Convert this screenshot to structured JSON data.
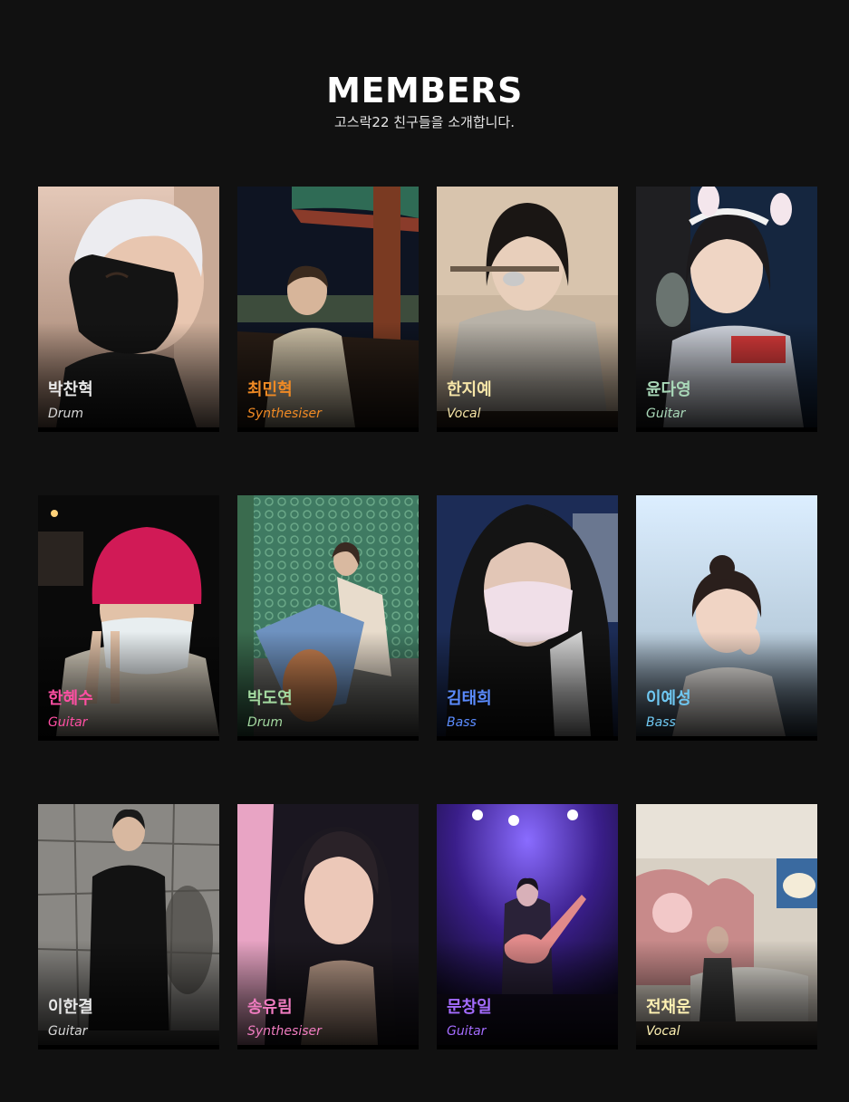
{
  "page": {
    "title": "MEMBERS",
    "subtitle": "고스락22 친구들을 소개합니다."
  },
  "members": [
    {
      "name": "박찬혁",
      "role": "Drum",
      "name_color": "#e8e8e8",
      "role_color": "#d8d8d8"
    },
    {
      "name": "최민혁",
      "role": "Synthesiser",
      "name_color": "#f08a24",
      "role_color": "#f08a24"
    },
    {
      "name": "한지예",
      "role": "Vocal",
      "name_color": "#f7e6a8",
      "role_color": "#f7e6a8"
    },
    {
      "name": "윤다영",
      "role": "Guitar",
      "name_color": "#a9d8b8",
      "role_color": "#a9d8b8"
    },
    {
      "name": "한혜수",
      "role": "Guitar",
      "name_color": "#ff4fa3",
      "role_color": "#ff4fa3"
    },
    {
      "name": "박도연",
      "role": "Drum",
      "name_color": "#a3d9a0",
      "role_color": "#a3d9a0"
    },
    {
      "name": "김태희",
      "role": "Bass",
      "name_color": "#5b8cff",
      "role_color": "#5b8cff"
    },
    {
      "name": "이예성",
      "role": "Bass",
      "name_color": "#6fc8f2",
      "role_color": "#6fc8f2"
    },
    {
      "name": "이한결",
      "role": "Guitar",
      "name_color": "#e8e8e8",
      "role_color": "#d8d8d8"
    },
    {
      "name": "송유림",
      "role": "Synthesiser",
      "name_color": "#f07cc0",
      "role_color": "#f07cc0"
    },
    {
      "name": "문창일",
      "role": "Guitar",
      "name_color": "#a46cff",
      "role_color": "#a46cff"
    },
    {
      "name": "전채운",
      "role": "Vocal",
      "name_color": "#fff2b3",
      "role_color": "#fff2b3"
    }
  ],
  "colors": {
    "background": "#111111",
    "title": "#ffffff",
    "subtitle": "#e6e6e6"
  }
}
